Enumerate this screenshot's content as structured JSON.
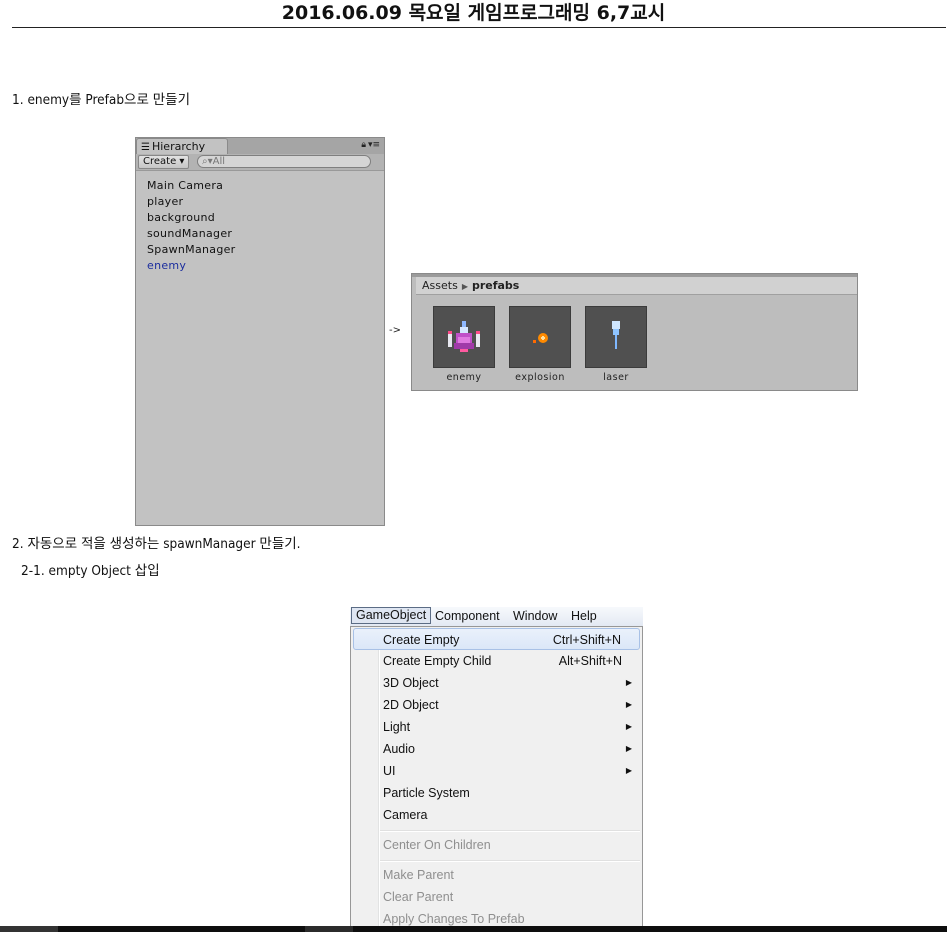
{
  "doc": {
    "title": "2016.06.09 목요일 게임프로그래밍 6,7교시",
    "step1": "1. enemy를 Prefab으로 만들기",
    "step2": "2. 자동으로 적을 생성하는 spawnManager 만들기.",
    "step2_1": "2-1. empty Object 삽입",
    "arrow": "->"
  },
  "hierarchy": {
    "tab_label": "Hierarchy",
    "create_label": "Create ▾",
    "search_placeholder": "All",
    "items": [
      {
        "label": "Main Camera",
        "prefab": false
      },
      {
        "label": "player",
        "prefab": false
      },
      {
        "label": "background",
        "prefab": false
      },
      {
        "label": "soundManager",
        "prefab": false
      },
      {
        "label": "SpawnManager",
        "prefab": false
      },
      {
        "label": "enemy",
        "prefab": true
      }
    ]
  },
  "project": {
    "breadcrumb_root": "Assets",
    "breadcrumb_current": "prefabs",
    "assets": [
      {
        "label": "enemy",
        "icon": "enemy-ship-icon"
      },
      {
        "label": "explosion",
        "icon": "explosion-icon"
      },
      {
        "label": "laser",
        "icon": "laser-icon"
      }
    ]
  },
  "menubar": {
    "items": [
      "GameObject",
      "Component",
      "Window",
      "Help"
    ],
    "open": "GameObject"
  },
  "menu": {
    "items": [
      {
        "label": "Create Empty",
        "shortcut": "Ctrl+Shift+N",
        "highlighted": true
      },
      {
        "label": "Create Empty Child",
        "shortcut": "Alt+Shift+N"
      },
      {
        "label": "3D Object",
        "submenu": true
      },
      {
        "label": "2D Object",
        "submenu": true
      },
      {
        "label": "Light",
        "submenu": true
      },
      {
        "label": "Audio",
        "submenu": true
      },
      {
        "label": "UI",
        "submenu": true
      },
      {
        "label": "Particle System"
      },
      {
        "label": "Camera"
      },
      {
        "label": "Center On Children",
        "disabled": true
      },
      {
        "label": "Make Parent",
        "disabled": true
      },
      {
        "label": "Clear Parent",
        "disabled": true
      },
      {
        "label": "Apply Changes To Prefab",
        "disabled": true
      }
    ],
    "submenu_glyph": "▶"
  },
  "colors": {
    "prefab_text": "#1b2d9e",
    "menu_highlight": "#dbe7f8",
    "disabled_text": "#8f8f8f"
  }
}
